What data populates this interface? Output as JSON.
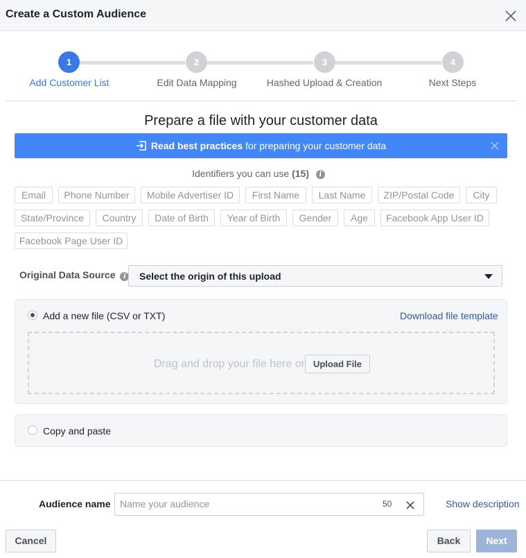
{
  "dialog": {
    "title": "Create a Custom Audience"
  },
  "steps": [
    {
      "number": "1",
      "label": "Add Customer List",
      "active": true
    },
    {
      "number": "2",
      "label": "Edit Data Mapping",
      "active": false
    },
    {
      "number": "3",
      "label": "Hashed Upload & Creation",
      "active": false
    },
    {
      "number": "4",
      "label": "Next Steps",
      "active": false
    }
  ],
  "prepare": {
    "title": "Prepare a file with your customer data",
    "banner_bold": "Read best practices",
    "banner_rest": " for preparing your customer data"
  },
  "identifiers": {
    "heading": "Identifiers you can use",
    "count": "(15)",
    "items": [
      "Email",
      "Phone Number",
      "Mobile Advertiser ID",
      "First Name",
      "Last Name",
      "ZIP/Postal Code",
      "City",
      "State/Province",
      "Country",
      "Date of Birth",
      "Year of Birth",
      "Gender",
      "Age",
      "Facebook App User ID",
      "Facebook Page User ID"
    ]
  },
  "source": {
    "label": "Original Data Source",
    "selected": "Select the origin of this upload"
  },
  "upload": {
    "option_label": "Add a new file (CSV or TXT)",
    "template_link": "Download file template",
    "drop_text": "Drag and drop your file here or",
    "button": "Upload File"
  },
  "paste": {
    "option_label": "Copy and paste"
  },
  "audience": {
    "label": "Audience name",
    "placeholder": "Name your audience",
    "char_count": "50",
    "show_description": "Show description"
  },
  "footer": {
    "cancel": "Cancel",
    "back": "Back",
    "next": "Next"
  },
  "colors": {
    "accent": "#3b78e7",
    "banner": "#4286f7",
    "link": "#365899",
    "next_disabled": "#9cb4d8"
  },
  "icons": {
    "close": "close-icon",
    "info": "info-icon",
    "banner": "sign-in-icon",
    "dropdown": "caret-down-icon"
  }
}
